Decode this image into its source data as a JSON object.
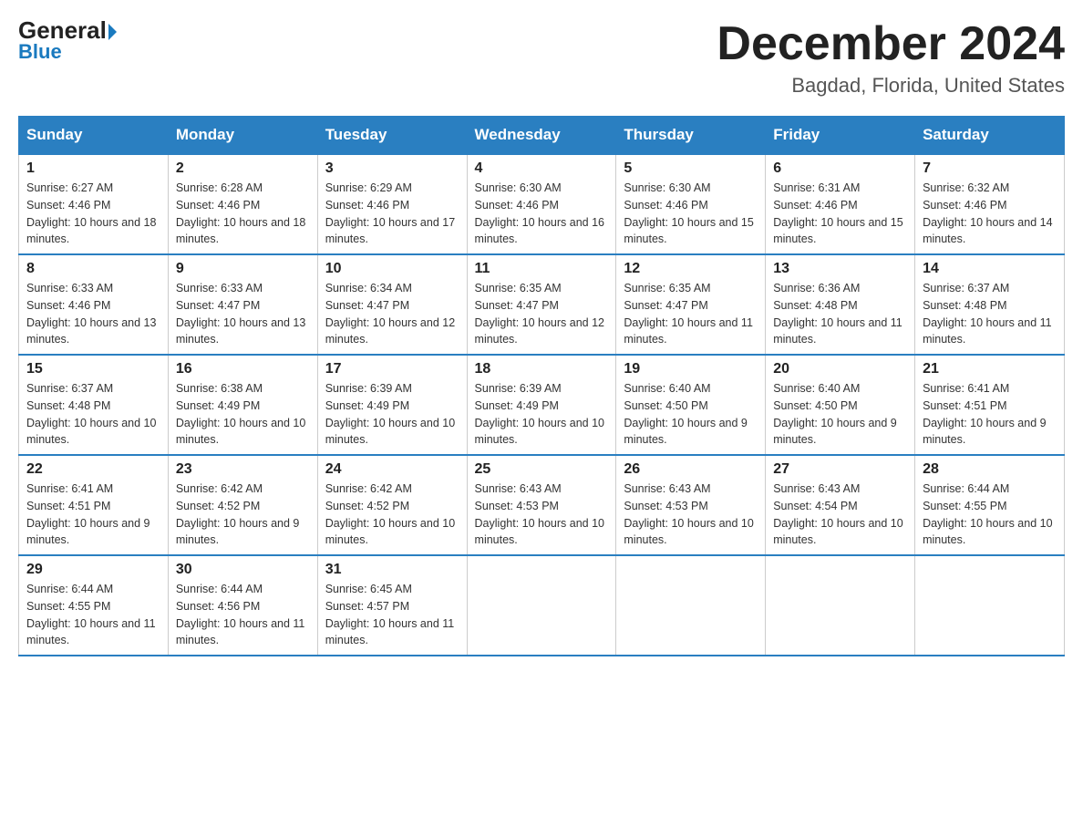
{
  "header": {
    "logo_line1": "General",
    "logo_line2": "Blue",
    "month_title": "December 2024",
    "location": "Bagdad, Florida, United States"
  },
  "days_of_week": [
    "Sunday",
    "Monday",
    "Tuesday",
    "Wednesday",
    "Thursday",
    "Friday",
    "Saturday"
  ],
  "weeks": [
    [
      {
        "day": "1",
        "sunrise": "6:27 AM",
        "sunset": "4:46 PM",
        "daylight": "10 hours and 18 minutes."
      },
      {
        "day": "2",
        "sunrise": "6:28 AM",
        "sunset": "4:46 PM",
        "daylight": "10 hours and 18 minutes."
      },
      {
        "day": "3",
        "sunrise": "6:29 AM",
        "sunset": "4:46 PM",
        "daylight": "10 hours and 17 minutes."
      },
      {
        "day": "4",
        "sunrise": "6:30 AM",
        "sunset": "4:46 PM",
        "daylight": "10 hours and 16 minutes."
      },
      {
        "day": "5",
        "sunrise": "6:30 AM",
        "sunset": "4:46 PM",
        "daylight": "10 hours and 15 minutes."
      },
      {
        "day": "6",
        "sunrise": "6:31 AM",
        "sunset": "4:46 PM",
        "daylight": "10 hours and 15 minutes."
      },
      {
        "day": "7",
        "sunrise": "6:32 AM",
        "sunset": "4:46 PM",
        "daylight": "10 hours and 14 minutes."
      }
    ],
    [
      {
        "day": "8",
        "sunrise": "6:33 AM",
        "sunset": "4:46 PM",
        "daylight": "10 hours and 13 minutes."
      },
      {
        "day": "9",
        "sunrise": "6:33 AM",
        "sunset": "4:47 PM",
        "daylight": "10 hours and 13 minutes."
      },
      {
        "day": "10",
        "sunrise": "6:34 AM",
        "sunset": "4:47 PM",
        "daylight": "10 hours and 12 minutes."
      },
      {
        "day": "11",
        "sunrise": "6:35 AM",
        "sunset": "4:47 PM",
        "daylight": "10 hours and 12 minutes."
      },
      {
        "day": "12",
        "sunrise": "6:35 AM",
        "sunset": "4:47 PM",
        "daylight": "10 hours and 11 minutes."
      },
      {
        "day": "13",
        "sunrise": "6:36 AM",
        "sunset": "4:48 PM",
        "daylight": "10 hours and 11 minutes."
      },
      {
        "day": "14",
        "sunrise": "6:37 AM",
        "sunset": "4:48 PM",
        "daylight": "10 hours and 11 minutes."
      }
    ],
    [
      {
        "day": "15",
        "sunrise": "6:37 AM",
        "sunset": "4:48 PM",
        "daylight": "10 hours and 10 minutes."
      },
      {
        "day": "16",
        "sunrise": "6:38 AM",
        "sunset": "4:49 PM",
        "daylight": "10 hours and 10 minutes."
      },
      {
        "day": "17",
        "sunrise": "6:39 AM",
        "sunset": "4:49 PM",
        "daylight": "10 hours and 10 minutes."
      },
      {
        "day": "18",
        "sunrise": "6:39 AM",
        "sunset": "4:49 PM",
        "daylight": "10 hours and 10 minutes."
      },
      {
        "day": "19",
        "sunrise": "6:40 AM",
        "sunset": "4:50 PM",
        "daylight": "10 hours and 9 minutes."
      },
      {
        "day": "20",
        "sunrise": "6:40 AM",
        "sunset": "4:50 PM",
        "daylight": "10 hours and 9 minutes."
      },
      {
        "day": "21",
        "sunrise": "6:41 AM",
        "sunset": "4:51 PM",
        "daylight": "10 hours and 9 minutes."
      }
    ],
    [
      {
        "day": "22",
        "sunrise": "6:41 AM",
        "sunset": "4:51 PM",
        "daylight": "10 hours and 9 minutes."
      },
      {
        "day": "23",
        "sunrise": "6:42 AM",
        "sunset": "4:52 PM",
        "daylight": "10 hours and 9 minutes."
      },
      {
        "day": "24",
        "sunrise": "6:42 AM",
        "sunset": "4:52 PM",
        "daylight": "10 hours and 10 minutes."
      },
      {
        "day": "25",
        "sunrise": "6:43 AM",
        "sunset": "4:53 PM",
        "daylight": "10 hours and 10 minutes."
      },
      {
        "day": "26",
        "sunrise": "6:43 AM",
        "sunset": "4:53 PM",
        "daylight": "10 hours and 10 minutes."
      },
      {
        "day": "27",
        "sunrise": "6:43 AM",
        "sunset": "4:54 PM",
        "daylight": "10 hours and 10 minutes."
      },
      {
        "day": "28",
        "sunrise": "6:44 AM",
        "sunset": "4:55 PM",
        "daylight": "10 hours and 10 minutes."
      }
    ],
    [
      {
        "day": "29",
        "sunrise": "6:44 AM",
        "sunset": "4:55 PM",
        "daylight": "10 hours and 11 minutes."
      },
      {
        "day": "30",
        "sunrise": "6:44 AM",
        "sunset": "4:56 PM",
        "daylight": "10 hours and 11 minutes."
      },
      {
        "day": "31",
        "sunrise": "6:45 AM",
        "sunset": "4:57 PM",
        "daylight": "10 hours and 11 minutes."
      },
      null,
      null,
      null,
      null
    ]
  ]
}
